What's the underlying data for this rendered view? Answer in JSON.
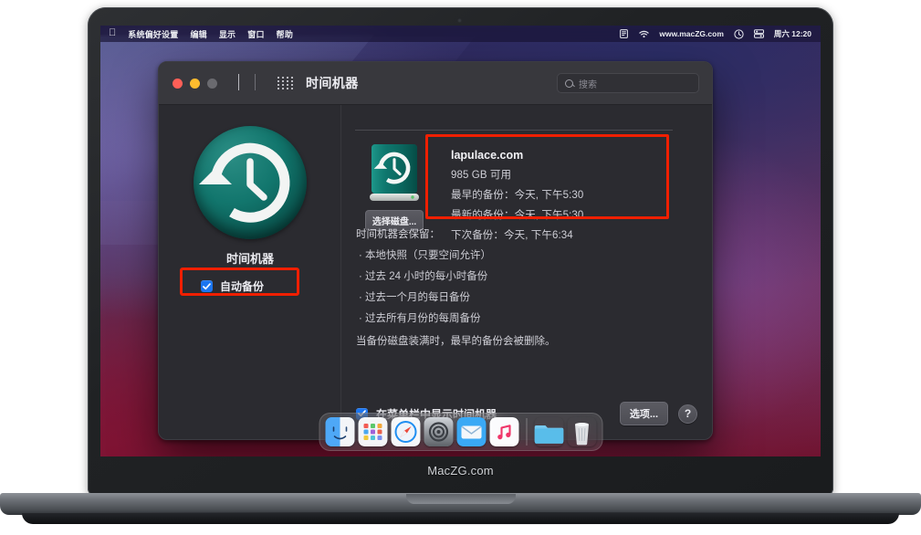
{
  "device": {
    "bezel_label": "MacZG.com"
  },
  "menubar": {
    "apple": "",
    "items": [
      "系统偏好设置",
      "编辑",
      "显示",
      "窗口",
      "帮助"
    ],
    "status": {
      "display_icon": "display-icon",
      "wifi_icon": "wifi-icon",
      "site": "www.macZG.com",
      "clock_icon": "clock-icon",
      "control_center_icon": "control-center-icon",
      "datetime": "周六 12:20"
    }
  },
  "window": {
    "title": "时间机器",
    "traffic_lights": [
      "close",
      "minimize",
      "zoom"
    ],
    "nav": {
      "back_icon": "chevron-left-icon",
      "forward_icon": "chevron-right-icon",
      "grid_icon": "grid-icon"
    },
    "search": {
      "placeholder": "搜索",
      "icon": "search-icon"
    }
  },
  "sidebar": {
    "app_icon": "time-machine-icon",
    "title": "时间机器",
    "auto_backup": {
      "label": "自动备份",
      "checked": true,
      "highlighted": true
    }
  },
  "content": {
    "disk": {
      "icon": "backup-disk-icon",
      "choose_disk_button": "选择磁盘...",
      "name": "lapulace.com",
      "available": "985 GB 可用",
      "oldest_backup": "最早的备份：今天, 下午5:30",
      "latest_backup": "最新的备份：今天, 下午5:30",
      "next_backup": "下次备份：今天, 下午6:34",
      "highlighted": true
    },
    "keep": {
      "title": "时间机器会保留：",
      "bullets": [
        "· 本地快照（只要空间允许）",
        "· 过去 24 小时的每小时备份",
        "· 过去一个月的每日备份",
        "· 过去所有月份的每周备份"
      ],
      "footnote": "当备份磁盘装满时，最早的备份会被删除。"
    },
    "bottom": {
      "show_in_menubar": {
        "label": "在菜单栏中显示时间机器",
        "checked": true
      },
      "options_button": "选项...",
      "help_button": "?"
    }
  },
  "dock": {
    "items": [
      {
        "name": "finder-icon",
        "running": true
      },
      {
        "name": "launchpad-icon",
        "running": false
      },
      {
        "name": "safari-icon",
        "running": true
      },
      {
        "name": "system-preferences-icon",
        "running": true
      },
      {
        "name": "mail-icon",
        "running": false
      },
      {
        "name": "music-icon",
        "running": true
      },
      {
        "name": "folder-icon",
        "running": false
      },
      {
        "name": "trash-icon",
        "running": false
      }
    ]
  },
  "colors": {
    "accent_blue": "#1b75f0",
    "highlight_red": "#f01f00",
    "window_bg": "#2b2b30",
    "titlebar_bg": "#38383d",
    "disk_teal": "#12766d"
  }
}
